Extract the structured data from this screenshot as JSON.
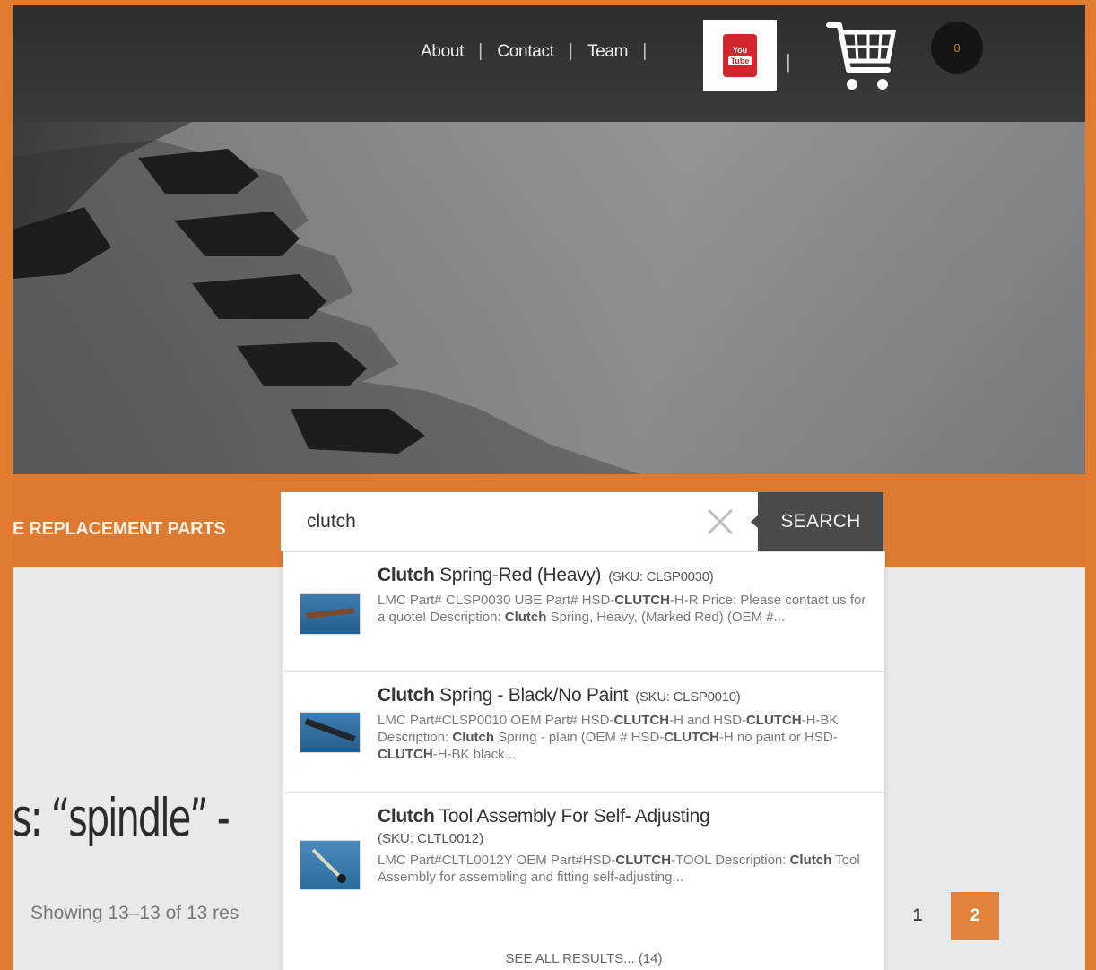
{
  "nav": {
    "about": "About",
    "contact": "Contact",
    "team": "Team",
    "sep": "|",
    "yt_top": "You",
    "yt_bottom": "Tube",
    "cart_count": "0"
  },
  "banner": {
    "brand_text": "E REPLACEMENT PARTS"
  },
  "search": {
    "query": "clutch",
    "button_label": "SEARCH"
  },
  "results": [
    {
      "title_bold": "Clutch",
      "title_rest": " Spring-Red (Heavy)",
      "sku": "(SKU: CLSP0030)",
      "desc1": "LMC Part# CLSP0030 UBE Part# HSD-",
      "desc1_bold": "CLUTCH",
      "desc1_rest": "-H-R Price: Please contact us for a quote! Description: ",
      "desc2_bold": "Clutch",
      "desc2_rest": " Spring, Heavy, (Marked Red) (OEM #..."
    },
    {
      "title_bold": "Clutch",
      "title_rest": " Spring - Black/No Paint",
      "sku": "(SKU: CLSP0010)",
      "desc1": "LMC Part#CLSP0010 OEM Part# HSD-",
      "desc1_bold": "CLUTCH",
      "desc1_rest": "-H and HSD-",
      "desc1b_bold": "CLUTCH",
      "desc1b_rest": "-H-BK Description: ",
      "desc2_bold": "Clutch",
      "desc2_rest": " Spring - plain (OEM # HSD-",
      "desc3_bold": "CLUTCH",
      "desc3_rest": "-H no paint or HSD-",
      "desc4_bold": "CLUTCH",
      "desc4_rest": "-H-BK black..."
    },
    {
      "title_bold": "Clutch",
      "title_rest": " Tool Assembly For Self- Adjusting",
      "sku": "(SKU: CLTL0012)",
      "desc1": "LMC Part#CLTL0012Y OEM Part#HSD-",
      "desc1_bold": "CLUTCH",
      "desc1_rest": "-TOOL Description: ",
      "desc2_bold": "Clutch",
      "desc2_rest": " Tool Assembly for assembling and fitting self-adjusting..."
    }
  ],
  "see_all": "SEE ALL RESULTS... (14)",
  "page_heading": "s: “spindle” -",
  "showing": "Showing 13–13 of 13 res",
  "pagination": [
    "1",
    "2"
  ],
  "colors": {
    "accent": "#dd7a31",
    "page_active": "#e1833d",
    "topbar": "#333333"
  }
}
